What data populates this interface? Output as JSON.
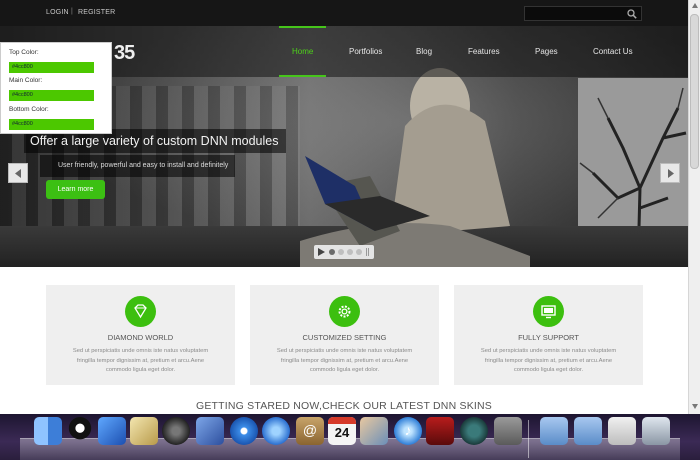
{
  "topbar": {
    "login": "LOGIN",
    "separator": "|",
    "register": "REGISTER",
    "search_placeholder": ""
  },
  "nav": {
    "logo": "35",
    "items": [
      "Home",
      "Portfolios",
      "Blog",
      "Features",
      "Pages",
      "Contact Us"
    ],
    "active": "Home"
  },
  "slider": {
    "title": "Offer a large variety of custom DNN modules",
    "subtitle": "User friendly, powerful and easy to install and definitely",
    "button": "Learn more",
    "slide_count": 4,
    "active_slide": 1
  },
  "color_panel": {
    "top_label": "Top Color:",
    "top_value": "#4cc800",
    "main_label": "Main Color:",
    "main_value": "#4cc800",
    "bottom_label": "Bottom Color:",
    "bottom_value": "#4cc800"
  },
  "features": [
    {
      "icon": "diamond-icon",
      "title": "DIAMOND WORLD",
      "desc": "Sed ut perspiciatis unde omnis iste natus voluptatem fringilla tempor dignissim at, pretium et arcu.Aene commodo ligula eget dolor."
    },
    {
      "icon": "gear-icon",
      "title": "CUSTOMIZED SETTING",
      "desc": "Sed ut perspiciatis unde omnis iste natus voluptatem fringilla tempor dignissim at, pretium et arcu.Aene commodo ligula eget dolor."
    },
    {
      "icon": "monitor-icon",
      "title": "FULLY SUPPORT",
      "desc": "Sed ut perspiciatis unde omnis iste natus voluptatem fringilla tempor dignissim at, pretium et arcu.Aene commodo ligula eget dolor."
    }
  ],
  "section_heading": "GETTING STARED NOW,CHECK OUR LATEST DNN SKINS",
  "dock": {
    "calendar_day": "24",
    "apps": [
      "finder-icon",
      "qq-icon",
      "xcode-icon",
      "preview-icon",
      "dashboard-icon",
      "mail-stamp-icon",
      "safari-icon",
      "facetime-icon",
      "address-book-icon",
      "calendar-icon",
      "photo-icon",
      "itunes-icon",
      "photo-booth-icon",
      "time-machine-icon",
      "system-preferences-icon",
      "applications-folder-icon",
      "documents-folder-icon",
      "downloads-icon",
      "trash-icon"
    ]
  },
  "colors": {
    "accent": "#3cc013",
    "nav_active": "#4ed11a",
    "swatch": "#4cc800"
  }
}
